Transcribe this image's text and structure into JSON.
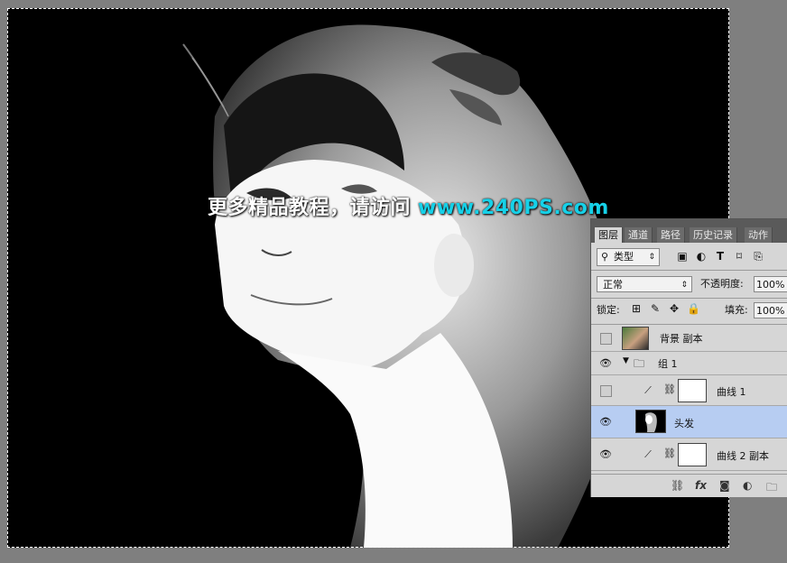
{
  "watermark": {
    "cn_text": "更多精品教程，请访问",
    "url": "www.240PS.com"
  },
  "layers_panel": {
    "tabs": [
      "图层",
      "通道",
      "路径",
      "历史记录",
      "动作"
    ],
    "filter": {
      "label": "类型",
      "search_icon": "search-icon",
      "caret": "⇕"
    },
    "filter_icons": [
      "image-icon",
      "adjustment-icon",
      "type-icon",
      "shape-icon",
      "smart-object-icon"
    ],
    "blend_mode": "正常",
    "opacity_label": "不透明度:",
    "opacity_value": "100%",
    "lock_label": "锁定:",
    "fill_label": "填充:",
    "fill_value": "100%",
    "layers": [
      {
        "name": "背景 副本",
        "visible": false,
        "type": "image"
      },
      {
        "name": "组 1",
        "visible": true,
        "type": "group"
      },
      {
        "name": "曲线 1",
        "visible": false,
        "type": "adjustment"
      },
      {
        "name": "头发",
        "visible": true,
        "type": "image",
        "selected": true
      },
      {
        "name": "曲线 2 副本",
        "visible": true,
        "type": "adjustment"
      }
    ],
    "bottom_icons": [
      "link-icon",
      "fx-icon",
      "mask-icon",
      "adjustment-layer-icon",
      "folder-icon"
    ],
    "fx_label": "fx"
  }
}
